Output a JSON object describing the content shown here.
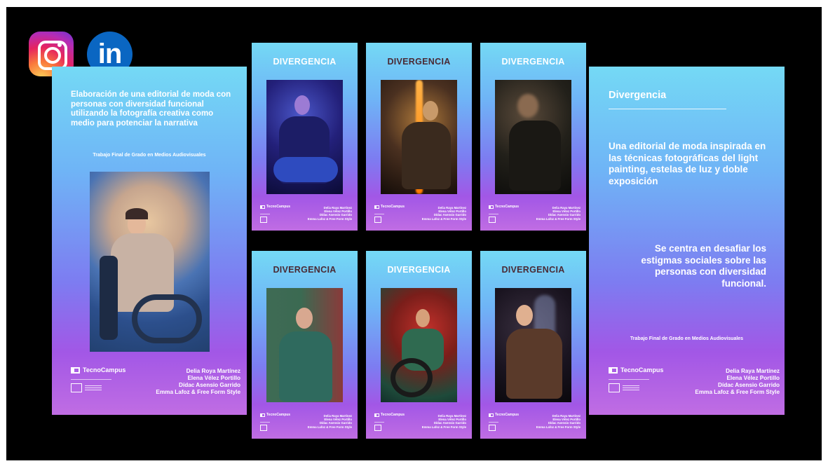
{
  "social": {
    "instagram_icon": "instagram-icon",
    "linkedin_icon": "linkedin-icon",
    "linkedin_text": "in"
  },
  "left_poster": {
    "intro": "Elaboración de una editorial de moda con personas con diversidad funcional utilizando la fotografía creativa como medio para potenciar la narrativa",
    "subtitle": "Trabajo Final de Grado en Medios Audiovisuales",
    "logo_text": "TecnoCampus",
    "credits": [
      "Delia Roya Martínez",
      "Elena Vélez Portillo",
      "Dídac Asensio Garrido",
      "Emma Lafoz & Free Form Style"
    ]
  },
  "small_posters": [
    {
      "title": "DIVERGENCIA"
    },
    {
      "title": "DIVERGENCIA"
    },
    {
      "title": "DIVERGENCIA"
    },
    {
      "title": "DIVERGENCIA"
    },
    {
      "title": "DIVERGENCIA"
    },
    {
      "title": "DIVERGENCIA"
    }
  ],
  "small_poster_footer": {
    "logo_text": "TecnoCampus",
    "credits": [
      "Delia Raya Martínez",
      "Elena Vélez Portillo",
      "Dídac Asensio Garrido",
      "Emma Lafoz & Free Form Style"
    ]
  },
  "right_poster": {
    "heading": "Divergencia",
    "description": "Una editorial de moda inspirada en las técnicas fotográficas del light painting, estelas de luz y doble exposición",
    "statement": "Se centra en desafiar los estigmas sociales sobre las personas con diversidad funcional.",
    "subtitle": "Trabajo Final de Grado en Medios Audiovisuales",
    "logo_text": "TecnoCampus",
    "credits": [
      "Delia Raya Martínez",
      "Elena Vélez Portillo",
      "Dídac Asensio Garrido",
      "Emma Lafoz & Free Form Style"
    ]
  }
}
